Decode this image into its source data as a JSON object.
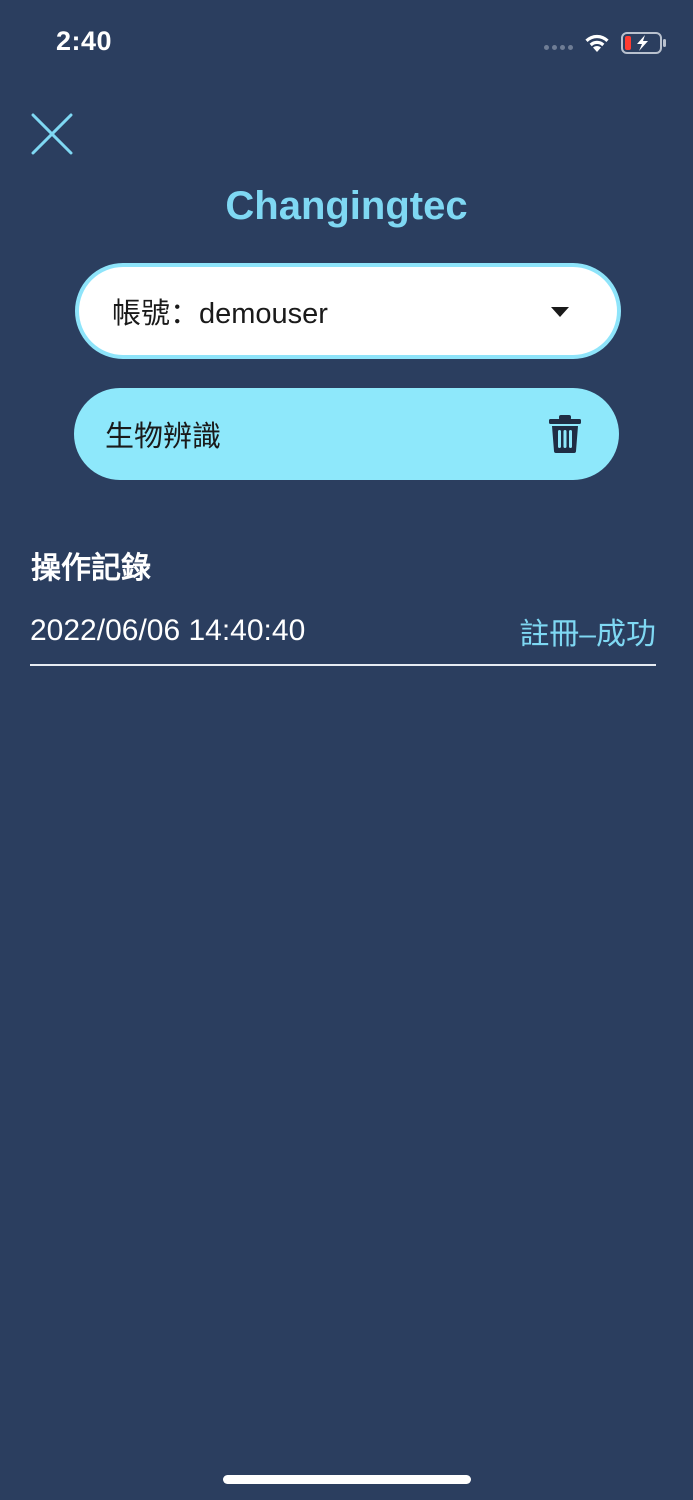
{
  "status_bar": {
    "time": "2:40"
  },
  "header": {
    "title": "Changingtec"
  },
  "account": {
    "label": "帳號：demouser"
  },
  "biometric": {
    "label": "生物辨識"
  },
  "log": {
    "heading": "操作記錄",
    "entries": [
      {
        "time": "2022/06/06 14:40:40",
        "status": "註冊–成功"
      }
    ]
  },
  "colors": {
    "background": "#2b3e5f",
    "accent": "#7fd8f3",
    "pill": "#8ee8fb"
  },
  "icons": {
    "close": "close-icon",
    "dropdown": "chevron-down-icon",
    "delete": "trash-icon",
    "wifi": "wifi-icon",
    "battery": "battery-charging-icon"
  }
}
